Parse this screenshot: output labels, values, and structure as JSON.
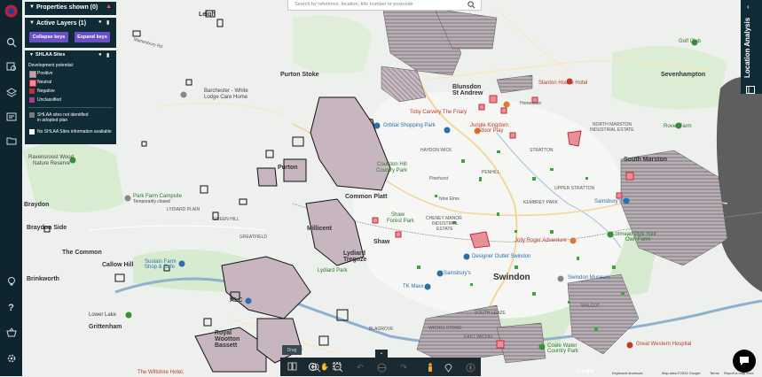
{
  "search": {
    "placeholder": "Search by reference, location, title number or postcode"
  },
  "properties_panel": {
    "title": "Properties shown (0)"
  },
  "layers_panel": {
    "title": "Active Layers (1)",
    "collapse_label": "Collapse keys",
    "expand_label": "Expand keys"
  },
  "shlaa_panel": {
    "title": "SHLAA Sites",
    "subtitle": "Development potential:",
    "legend": [
      {
        "label": "Positive",
        "color": "#c9a0ad"
      },
      {
        "label": "Neutral",
        "color": "#e8909a"
      },
      {
        "label": "Negative",
        "color": "#cc2a3a"
      },
      {
        "label": "Unclassified",
        "color": "#b03a8a"
      }
    ],
    "not_identified_line1": "SHLAA sites not identified",
    "not_identified_line2": "in adopted plan",
    "no_info": "No SHLAA Sites information available"
  },
  "location_tab": {
    "label": "Location Analysis"
  },
  "bottom_toolbar": {
    "badge": "Drag"
  },
  "map": {
    "labels": {
      "leigh": "Leigh",
      "mainesbury": "Mainesbury Rd",
      "purton_stoke": "Purton Stoke",
      "barchester": "Barchester - White",
      "lodge_care": "Lodge Care Home",
      "ravensroost_1": "Ravensroost Wood",
      "ravensroost_2": "Nature Reserve",
      "purton": "Purton",
      "park_farm_1": "Park Farm Campsite",
      "park_farm_2": "Temporarily closed",
      "lydiard_plain": "LYDIARD PLAIN",
      "green_hill": "GREEN HILL",
      "braydon_side": "Braydon Side",
      "braydon": "Braydon",
      "greatfield": "GREATFIELD",
      "common_platt": "Common Platt",
      "millicent": "Millicent",
      "the_common": "The Common",
      "callow_hill": "Callow Hill",
      "brinkworth": "Brinkworth",
      "sustain_farm_1": "Sustain Farm",
      "sustain_farm_2": "Shop & Cafe",
      "lydiard_park": "Lydiard Park",
      "lydiard_1": "Lydiard",
      "lydiard_2": "Tregoze",
      "shaw": "Shaw",
      "shaw_forest": "Shaw",
      "shaw_forest_2": "Forest Park",
      "blunsdon_1": "Blunsdon",
      "blunsdon_2": "St Andrew",
      "toby_carvery": "Toby Carvery The Friary",
      "orbital": "Orbital Shopping Park",
      "jungle_1": "Jungle Kingdom",
      "jungle_2": "Indoor Play",
      "haydon_wick": "HAYDON WICK",
      "coulston_1": "Coulston Hill",
      "coulston_2": "Country Park",
      "penhill": "PENHILL",
      "stratton": "STRATTON",
      "upper_stratton": "UPPER STRATTON",
      "north_marston_1": "NORTH MARSTON",
      "north_marston_2": "INDUSTRIAL ESTATE",
      "south_marston": "South Marston",
      "rover_farm": "Rover Farm",
      "nine_elms": "Nine Elms",
      "cheney_1": "CHENEY MANOR",
      "cheney_2": "INDUSTRIAL",
      "cheney_3": "ESTATE",
      "kembrey_park": "KEMBREY PARK",
      "sainsburys": "Sainsbury's",
      "lotmead_1": "Lotmead Pick Your",
      "lotmead_2": "Own Farm",
      "jolly_roger": "Jolly Roger Adventure",
      "swindon": "Swindon",
      "designer_outlet": "Designer Outlet Swindon",
      "sainsburys2": "Sainsbury's",
      "tk_maxx": "TK Maxx",
      "swindon_museum": "Swindon Museum",
      "south_leaze": "SOUTH LEAZE",
      "walcot": "WALCOT",
      "wichelstowe": "WICHELSTOWE",
      "east_wichel": "EAST WICHEL",
      "lower_blagrove": "BLAGROVE",
      "coate_1": "Coate Water",
      "coate_2": "Country Park",
      "great_western": "Great Western Hospital",
      "royal_wootton_1": "Royal",
      "royal_wootton_2": "Wootton",
      "royal_wootton_3": "Bassett",
      "grittenham": "Grittenham",
      "wiltshire_hotel": "The Wiltshire Hotel,",
      "lower_lake": "Lower Lake",
      "startham": "Stanton House Hotel",
      "stanton_house": "Stanton House Hotel",
      "shaw_country": "Country Park",
      "sevenhampton": "Sevenhampton",
      "golf_club": "Golf Club",
      "homebase": "Homebase",
      "pinehurst": "Pinehurst",
      "alc": "ALC"
    }
  },
  "footer": {
    "google": "Google",
    "keyboard": "Keyboard shortcuts",
    "mapdata": "Map data ©2024 Google",
    "terms": "Terms",
    "report": "Report a map error"
  },
  "colors": {
    "rail": "#0e2530",
    "panel": "#0f2b36",
    "button": "#6b4fc7",
    "road_major": "#8fb0cf",
    "land": "#eef1ee",
    "green": "#c8e6c2",
    "urban": "#f5f5f5",
    "site_fill": "#c9a0ad",
    "site_fill2": "#b9a9b3",
    "hatch": "#777"
  }
}
